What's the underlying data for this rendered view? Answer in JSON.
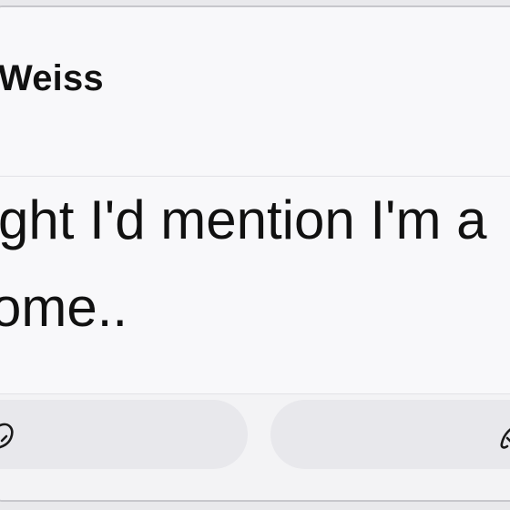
{
  "header": {
    "sender_name": "Weiss"
  },
  "message": {
    "lines": [
      "ght I'd mention I'm a",
      "ome.."
    ]
  },
  "actions": {
    "left_icon": "reply-icon",
    "right_icon": "forward-icon"
  }
}
